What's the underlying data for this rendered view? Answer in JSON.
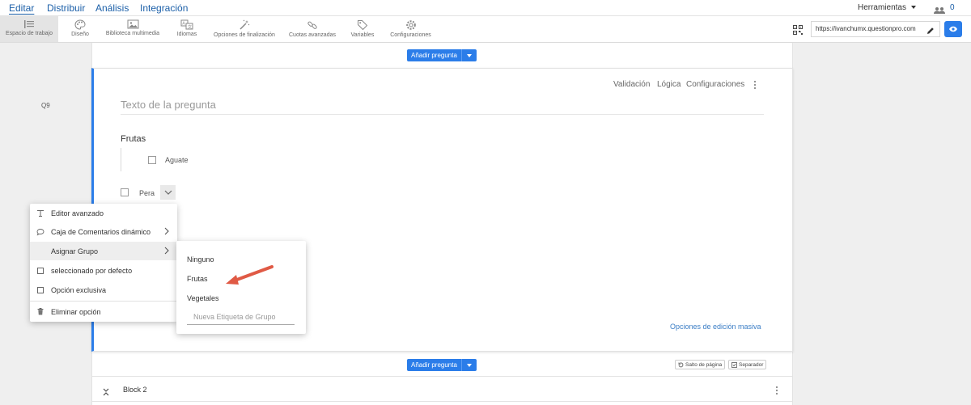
{
  "nav": {
    "tabs": [
      {
        "label": "Editar",
        "active": true
      },
      {
        "label": "Distribuir"
      },
      {
        "label": "Análisis"
      },
      {
        "label": "Integración"
      }
    ],
    "tools_label": "Herramientas",
    "users_count": "0"
  },
  "toolbar": {
    "items": [
      {
        "label": "Espacio de trabajo",
        "icon": "workspace-icon",
        "active": true
      },
      {
        "label": "Diseño",
        "icon": "palette-icon"
      },
      {
        "label": "Biblioteca multimedia",
        "icon": "image-icon"
      },
      {
        "label": "Idiomas",
        "icon": "language-icon"
      },
      {
        "label": "Opciones de finalización",
        "icon": "magic-wand-icon"
      },
      {
        "label": "Cuotas avanzadas",
        "icon": "link-icon"
      },
      {
        "label": "Variables",
        "icon": "tag-icon"
      },
      {
        "label": "Configuraciones",
        "icon": "gear-icon"
      }
    ],
    "url": "https://ivanchumx.questionpro.com"
  },
  "editor": {
    "add_question_label": "Añadir pregunta",
    "question": {
      "number": "Q9",
      "placeholder": "Texto de la pregunta",
      "links": [
        "Validación",
        "Lógica",
        "Configuraciones"
      ],
      "group_title": "Frutas",
      "options": [
        "Aguate",
        "Pera"
      ],
      "bulk_edit_label": "Opciones de edición masiva"
    },
    "page_break_label": "Salto de página",
    "separator_label": "Separador",
    "block2_label": "Block 2"
  },
  "context_menu": {
    "items": [
      {
        "label": "Editor avanzado",
        "icon": "text-cursor-icon"
      },
      {
        "label": "Caja de Comentarios dinámico",
        "icon": "comment-icon"
      },
      {
        "label": "Asignar Grupo",
        "icon": ""
      },
      {
        "label": "seleccionado por defecto",
        "icon": "checkbox-icon"
      },
      {
        "label": "Opción exclusiva",
        "icon": "checkbox-icon"
      },
      {
        "label": "Eliminar opción",
        "icon": "trash-icon"
      }
    ]
  },
  "group_submenu": {
    "items": [
      "Ninguno",
      "Frutas",
      "Vegetales"
    ],
    "new_group_placeholder": "Nueva Etiqueta de Grupo"
  },
  "colors": {
    "accent": "#2b7de9",
    "nav_link": "#1b5fa8",
    "annotation_arrow": "#e05a45"
  }
}
